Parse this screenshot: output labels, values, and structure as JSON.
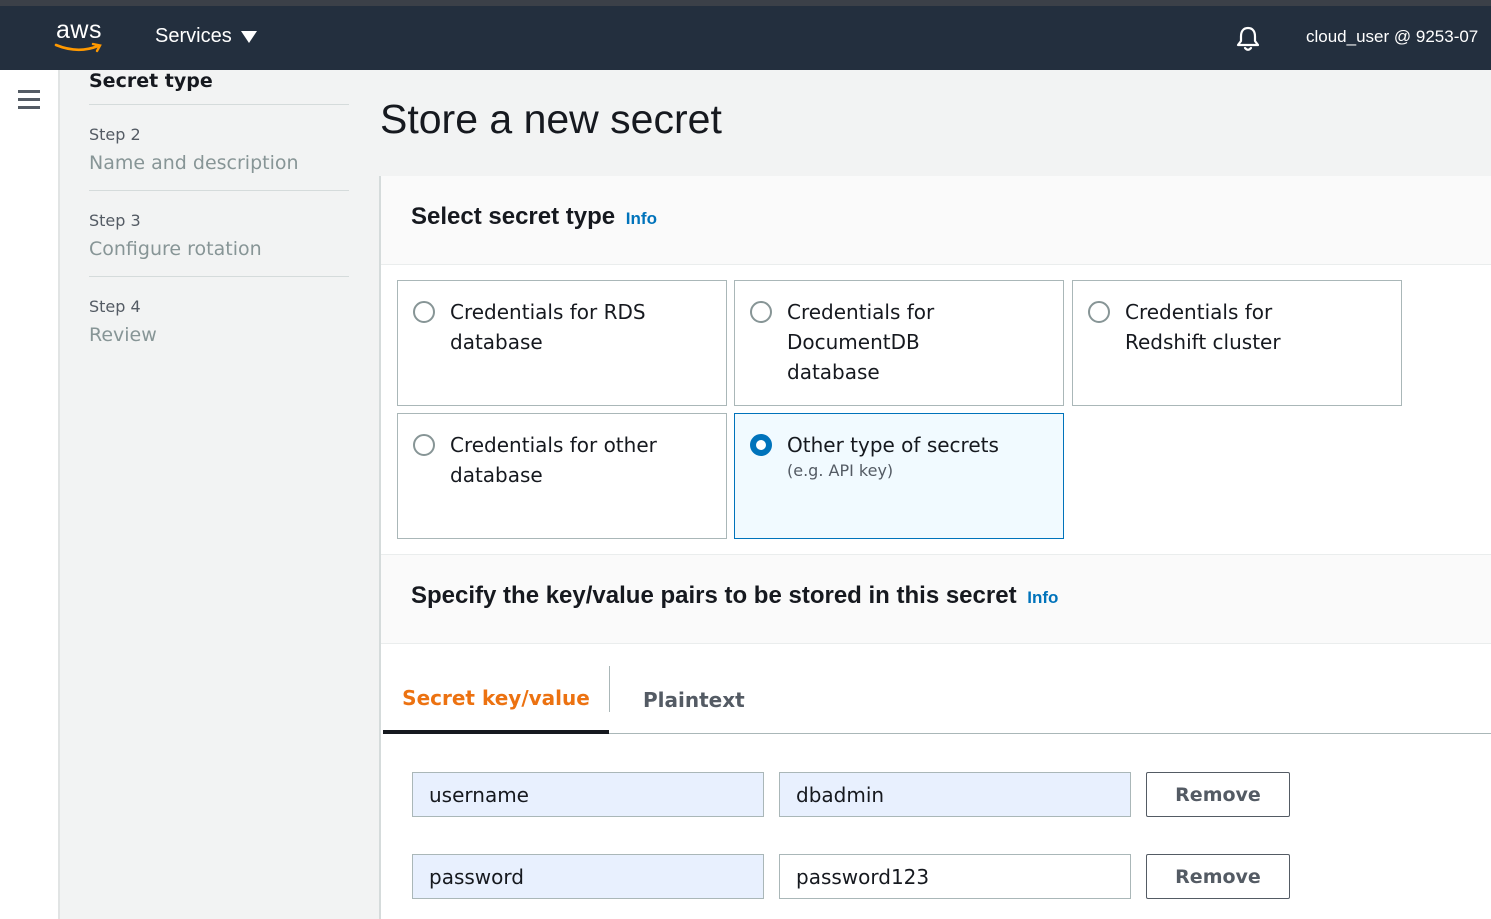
{
  "topnav": {
    "logo_text": "aws",
    "services_label": "Services",
    "account_label": "cloud_user @ 9253-07"
  },
  "steps": {
    "current_label": "Secret type",
    "items": [
      {
        "num": "Step 2",
        "label": "Name and description"
      },
      {
        "num": "Step 3",
        "label": "Configure rotation"
      },
      {
        "num": "Step 4",
        "label": "Review"
      }
    ]
  },
  "page": {
    "title": "Store a new secret"
  },
  "secret_type": {
    "heading": "Select secret type",
    "info_label": "Info",
    "options": [
      {
        "label": "Credentials for RDS database",
        "selected": false
      },
      {
        "label": "Credentials for DocumentDB database",
        "selected": false
      },
      {
        "label": "Credentials for Redshift cluster",
        "selected": false
      },
      {
        "label": "Credentials for other database",
        "selected": false
      },
      {
        "label": "Other type of secrets",
        "sublabel": "(e.g. API key)",
        "selected": true
      }
    ]
  },
  "kv_section": {
    "heading": "Specify the key/value pairs to be stored in this secret",
    "info_label": "Info",
    "tabs": [
      {
        "label": "Secret key/value",
        "active": true
      },
      {
        "label": "Plaintext",
        "active": false
      }
    ],
    "rows": [
      {
        "key": "username",
        "value": "dbadmin",
        "remove_label": "Remove"
      },
      {
        "key": "password",
        "value": "password123",
        "remove_label": "Remove"
      }
    ]
  },
  "colors": {
    "nav_bg": "#232f3e",
    "accent_orange": "#ec7211",
    "link_blue": "#0073bb",
    "selected_tile_bg": "#f1faff"
  }
}
